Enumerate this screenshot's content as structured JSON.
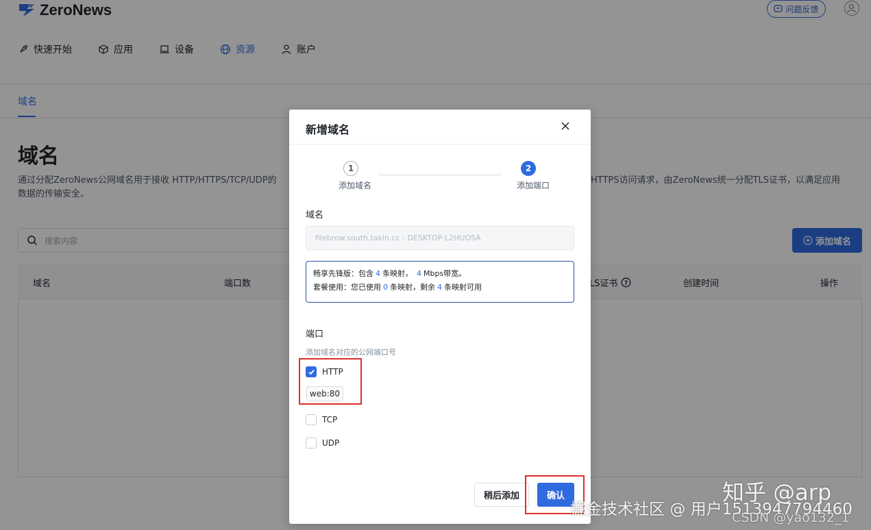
{
  "app": {
    "logo_text": "ZeroNews",
    "feedback_label": "问题反馈"
  },
  "nav": [
    {
      "label": "快速开始",
      "icon": "rocket-icon"
    },
    {
      "label": "应用",
      "icon": "cube-icon"
    },
    {
      "label": "设备",
      "icon": "laptop-icon"
    },
    {
      "label": "资源",
      "icon": "globe-icon",
      "active": true
    },
    {
      "label": "账户",
      "icon": "user-icon"
    }
  ],
  "subtab": {
    "label": "域名"
  },
  "page": {
    "title": "域名",
    "desc_left": "通过分配ZeroNews公网域名用于接收 HTTP/HTTPS/TCP/UDP的",
    "desc_left_2": "数据的传输安全。",
    "desc_right": "HTTPS访问请求，由ZeroNews统一分配TLS证书，以满足应用",
    "search_placeholder": "搜索内容",
    "add_button": "添加域名"
  },
  "table": {
    "headers": [
      "域名",
      "端口数",
      "TLS证书",
      "创建时间",
      "操作"
    ]
  },
  "modal": {
    "title": "新增域名",
    "steps": [
      {
        "num": "1",
        "label": "添加域名",
        "state": "done"
      },
      {
        "num": "2",
        "label": "添加端口",
        "state": "active"
      }
    ],
    "domain_label": "域名",
    "domain_value": "filebrow.south.takin.cc - DESKTOP-L2HUO5A",
    "plan": {
      "line1_a": "畅享先锋版：包含",
      "line1_n1": "4",
      "line1_b": "条映射，",
      "line1_n2": "4",
      "line1_c": "Mbps带宽。",
      "line2_a": "套餐使用：您已使用",
      "line2_n1": "0",
      "line2_b": "条映射，剩余",
      "line2_n2": "4",
      "line2_c": "条映射可用"
    },
    "port_label": "端口",
    "port_hint": "添加域名对应的公网端口号",
    "ports": [
      {
        "label": "HTTP",
        "checked": true,
        "tag": "web:80"
      },
      {
        "label": "TCP",
        "checked": false
      },
      {
        "label": "UDP",
        "checked": false
      }
    ],
    "later_button": "稍后添加",
    "confirm_button": "确认"
  },
  "watermarks": {
    "zhihu": "知乎 @arp",
    "juejin": "掘金技术社区 @ 用户1513947794460",
    "csdn": "CSDN @yao132_1"
  },
  "colors": {
    "accent": "#2f6be0",
    "highlight": "#d9302a"
  }
}
